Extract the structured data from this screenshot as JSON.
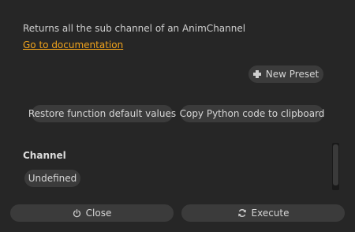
{
  "description": "Returns all the sub channel of an AnimChannel",
  "doc_link": "Go to documentation",
  "buttons": {
    "new_preset": "New Preset",
    "restore_defaults": "Restore function default values",
    "copy_python": "Copy Python code to clipboard",
    "close": "Close",
    "execute": "Execute"
  },
  "parameters": {
    "channel_label": "Channel",
    "channel_value": "Undefined"
  },
  "icons": {
    "new_preset": "plus-icon",
    "close": "power-icon",
    "execute": "refresh-icon"
  },
  "colors": {
    "link": "#f0a31c",
    "background": "#262626",
    "button": "#3b3b3b"
  }
}
